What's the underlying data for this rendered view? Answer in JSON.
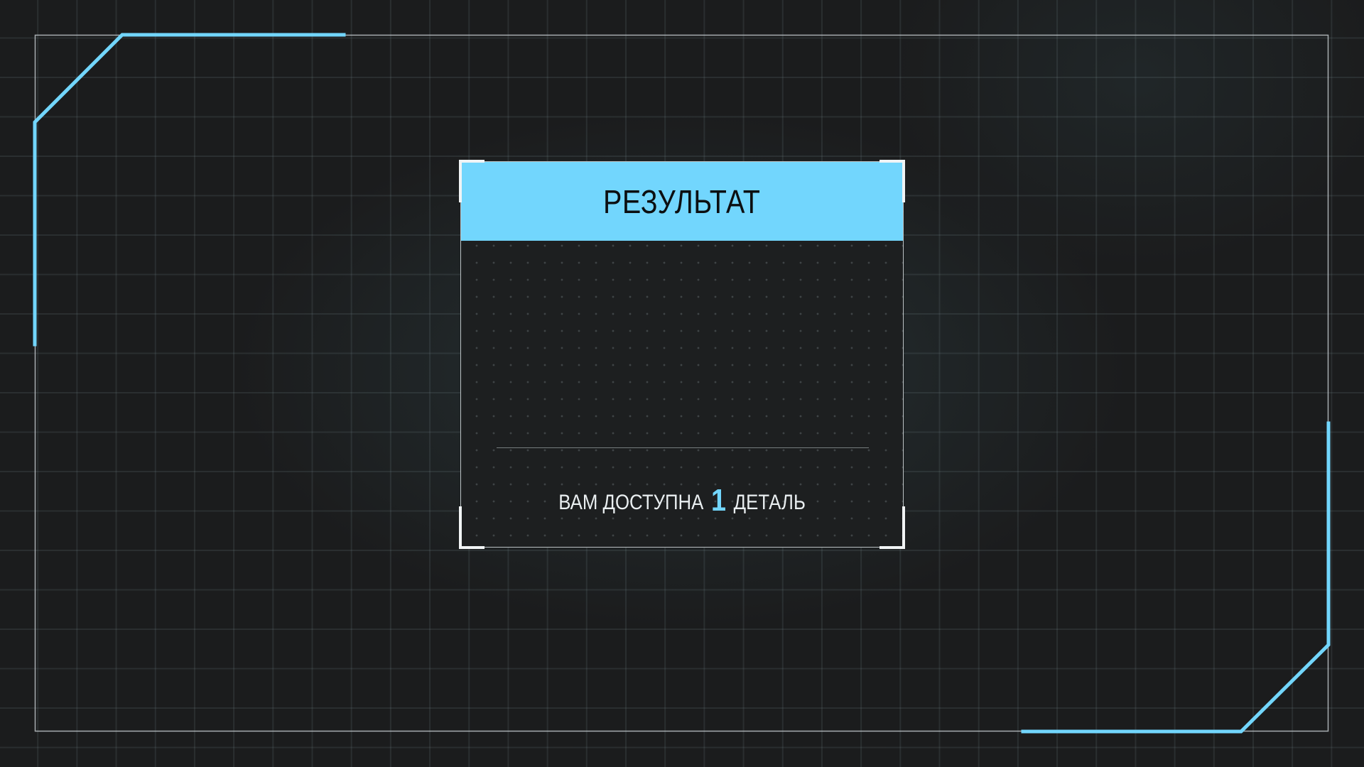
{
  "result_panel": {
    "title": "РЕЗУЛЬТАТ",
    "message_prefix": "ВАМ ДОСТУПНА",
    "count": "1",
    "message_suffix": "ДЕТАЛЬ"
  },
  "colors": {
    "accent": "#72d6fd",
    "background": "#1b1c1d",
    "frame_line": "#d7dee1",
    "title_text": "#0c0f11",
    "message_text": "#e9eef0"
  }
}
